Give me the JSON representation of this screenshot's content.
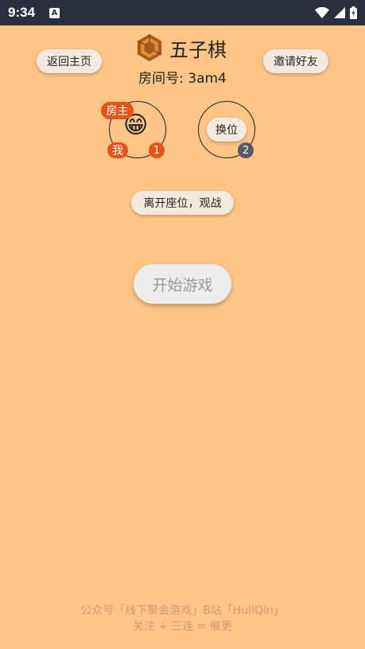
{
  "status_bar": {
    "time": "9:34",
    "notification_icon_letter": "A",
    "icons": [
      "wifi-icon",
      "cellular-signal-icon",
      "battery-icon"
    ]
  },
  "header": {
    "back_button_label": "返回主页",
    "title": "五子棋",
    "invite_button_label": "邀请好友",
    "room_label": "房间号: 3am4"
  },
  "seats": [
    {
      "host_tag": "房主",
      "me_tag": "我",
      "emoji": "😁",
      "number": "1"
    },
    {
      "swap_button_label": "换位",
      "number": "2"
    }
  ],
  "leave_seat_button_label": "离开座位，观战",
  "start_button_label": "开始游戏",
  "footer": {
    "line1": "公众号「线下聚会游戏」B站「HullQin」",
    "line2": "关注 + 三连 = 催更"
  },
  "colors": {
    "background": "#ffc587",
    "status_bar": "#2b2f3e",
    "tag_orange": "#e2541a",
    "seat2_badge": "#555a66",
    "logo_brown": "#a55a1b"
  }
}
